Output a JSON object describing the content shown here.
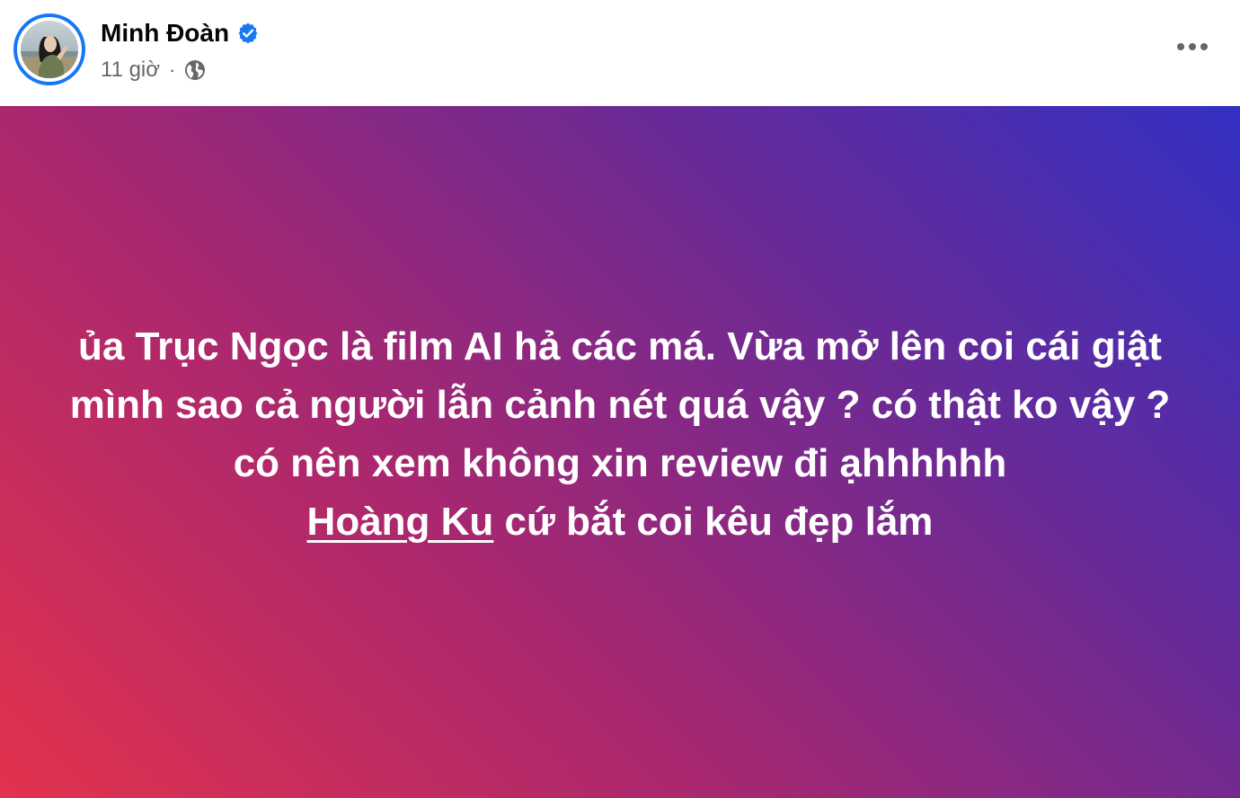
{
  "post": {
    "author": {
      "name": "Minh Đoàn",
      "verified": true,
      "avatar_icon": "profile-photo"
    },
    "timestamp": "11 giờ",
    "separator": "·",
    "privacy_icon": "globe-icon",
    "more_icon": "more-options-icon",
    "status": {
      "line1": "ủa Trục Ngọc là film AI hả các má. Vừa mở lên coi cái giật",
      "line2": "mình sao cả người lẫn cảnh nét quá vậy ? có thật ko vậy ?",
      "line3": "có nên xem không xin review đi ạhhhhhh",
      "mention": "Hoàng Ku",
      "line4_rest": " cứ bắt coi kêu đẹp lắm"
    },
    "colors": {
      "verified_badge": "#1877f2",
      "gradient_start": "#e2324d",
      "gradient_end": "#3330c3",
      "text": "#ffffff"
    }
  }
}
